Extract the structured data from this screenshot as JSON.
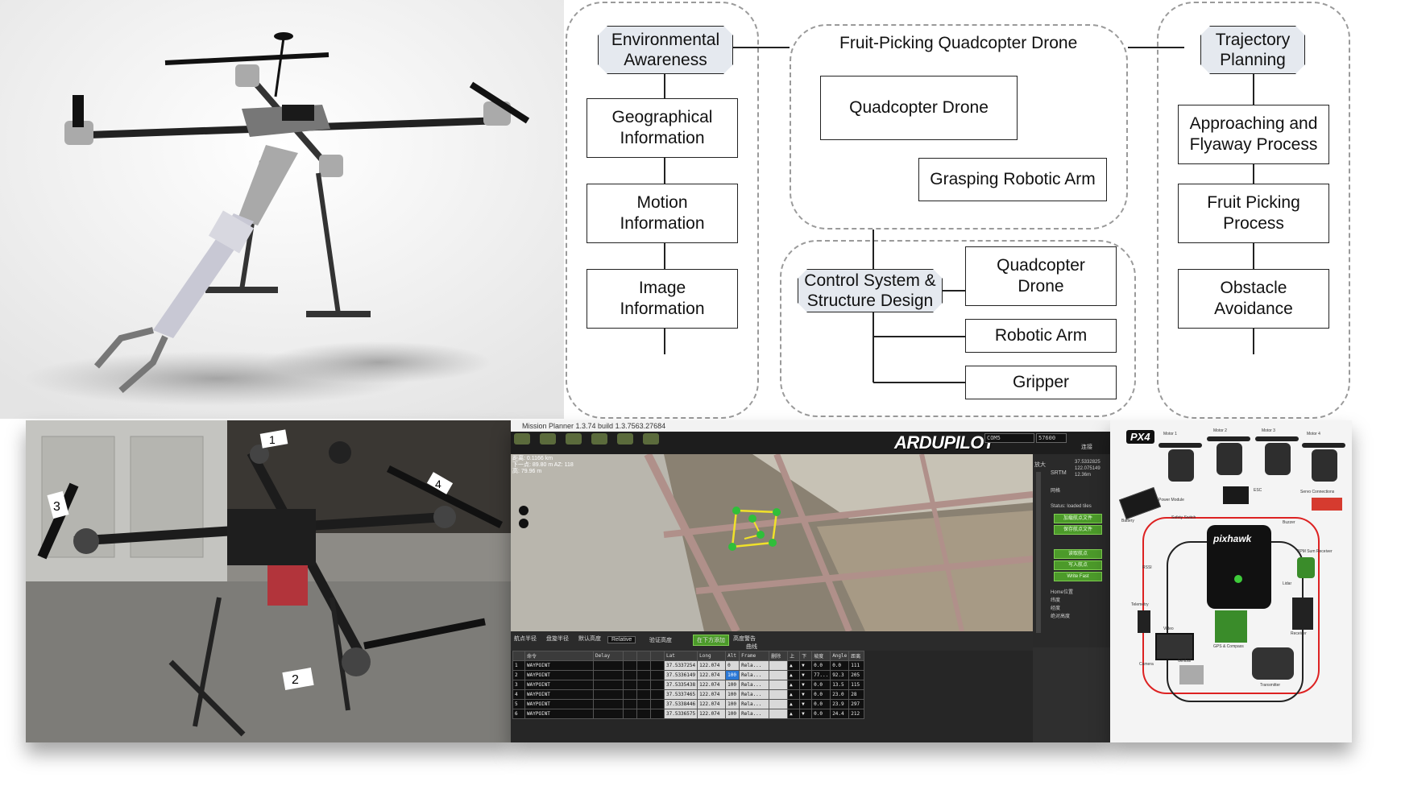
{
  "diagram": {
    "env_header": "Environmental\nAwareness",
    "env_items": [
      "Geographical\nInformation",
      "Motion\nInformation",
      "Image\nInformation"
    ],
    "center_title": "Fruit-Picking Quadcopter Drone",
    "center_items": [
      "Quadcopter Drone",
      "Grasping Robotic Arm"
    ],
    "control_header": "Control System &\nStructure Design",
    "control_items": [
      "Quadcopter\nDrone",
      "Robotic Arm",
      "Gripper"
    ],
    "traj_header": "Trajectory\nPlanning",
    "traj_items": [
      "Approaching and\nFlyaway Process",
      "Fruit Picking\nProcess",
      "Obstacle\nAvoidance"
    ]
  },
  "photo": {
    "arm_labels": [
      "1",
      "2",
      "3",
      "4"
    ]
  },
  "mission_planner": {
    "window_title": "Mission Planner 1.3.74 build 1.3.7563.27684",
    "brand": "ARDUPILOT",
    "port": "COM5",
    "baud": "57600",
    "connect_label": "连接",
    "map_info": [
      "距离: 0.1166 km",
      "下一点: 89.80 m AZ: 118",
      "高: 79.96 m"
    ],
    "srtm": "SRTM",
    "coords": [
      "37.5332825",
      "122.075149",
      "12.36m"
    ],
    "zoom_label": "放大",
    "tile_status": "Status: loaded tiles",
    "green_buttons": [
      "加载航点文件",
      "保存航点文件",
      "读取航点",
      "写入航点",
      "Write Fast"
    ],
    "side_labels": [
      "网格",
      "Home位置",
      "纬度",
      "经度",
      "绝对高度"
    ],
    "bottom_controls": {
      "wp_radius": "航点半径",
      "loiter_radius": "盘旋半径",
      "default_alt": "默认高度",
      "alt_mode": "Relative",
      "verify_height": "验证高度",
      "add_below": "在下方添加",
      "alt_warning": "高度警告",
      "spline": "曲线"
    },
    "table_headers": [
      "",
      "命令",
      "Delay",
      "",
      "",
      "",
      "Lat",
      "Long",
      "Alt",
      "Frame",
      "删除",
      "上",
      "下",
      "坡度",
      "Angle",
      "距离"
    ],
    "waypoints": [
      {
        "n": "1",
        "cmd": "WAYPOINT",
        "lat": "37.5337254",
        "lon": "122.074",
        "alt": "0",
        "frame": "Rela...",
        "grad": "0.0",
        "angle": "0.0",
        "dist": "111"
      },
      {
        "n": "2",
        "cmd": "WAYPOINT",
        "lat": "37.5336149",
        "lon": "122.074",
        "alt": "100",
        "frame": "Rela...",
        "grad": "77...",
        "angle": "92.3",
        "dist": "205"
      },
      {
        "n": "3",
        "cmd": "WAYPOINT",
        "lat": "37.5335438",
        "lon": "122.074",
        "alt": "100",
        "frame": "Rela...",
        "grad": "0.0",
        "angle": "13.5",
        "dist": "115"
      },
      {
        "n": "4",
        "cmd": "WAYPOINT",
        "lat": "37.5337465",
        "lon": "122.074",
        "alt": "100",
        "frame": "Rela...",
        "grad": "0.0",
        "angle": "23.0",
        "dist": "28"
      },
      {
        "n": "5",
        "cmd": "WAYPOINT",
        "lat": "37.5338446",
        "lon": "122.074",
        "alt": "100",
        "frame": "Rela...",
        "grad": "0.0",
        "angle": "23.9",
        "dist": "297"
      },
      {
        "n": "6",
        "cmd": "WAYPOINT",
        "lat": "37.5336575",
        "lon": "122.074",
        "alt": "100",
        "frame": "Rela...",
        "grad": "0.0",
        "angle": "24.4",
        "dist": "212"
      }
    ]
  },
  "px4": {
    "logo": "PX4",
    "controller": "pixhawk",
    "labels": [
      "Motor 1",
      "Motor 2",
      "Motor 3",
      "Motor 4",
      "ESC",
      "Buzzer",
      "Safety Switch",
      "Telemetry",
      "GPS & Compass",
      "Receiver",
      "Transmitter",
      "Power Module",
      "Servo Connections",
      "Battery",
      "Gimbal",
      "Camera",
      "Video",
      "RSSI",
      "Lidar",
      "PPM Sum Receiver"
    ]
  }
}
